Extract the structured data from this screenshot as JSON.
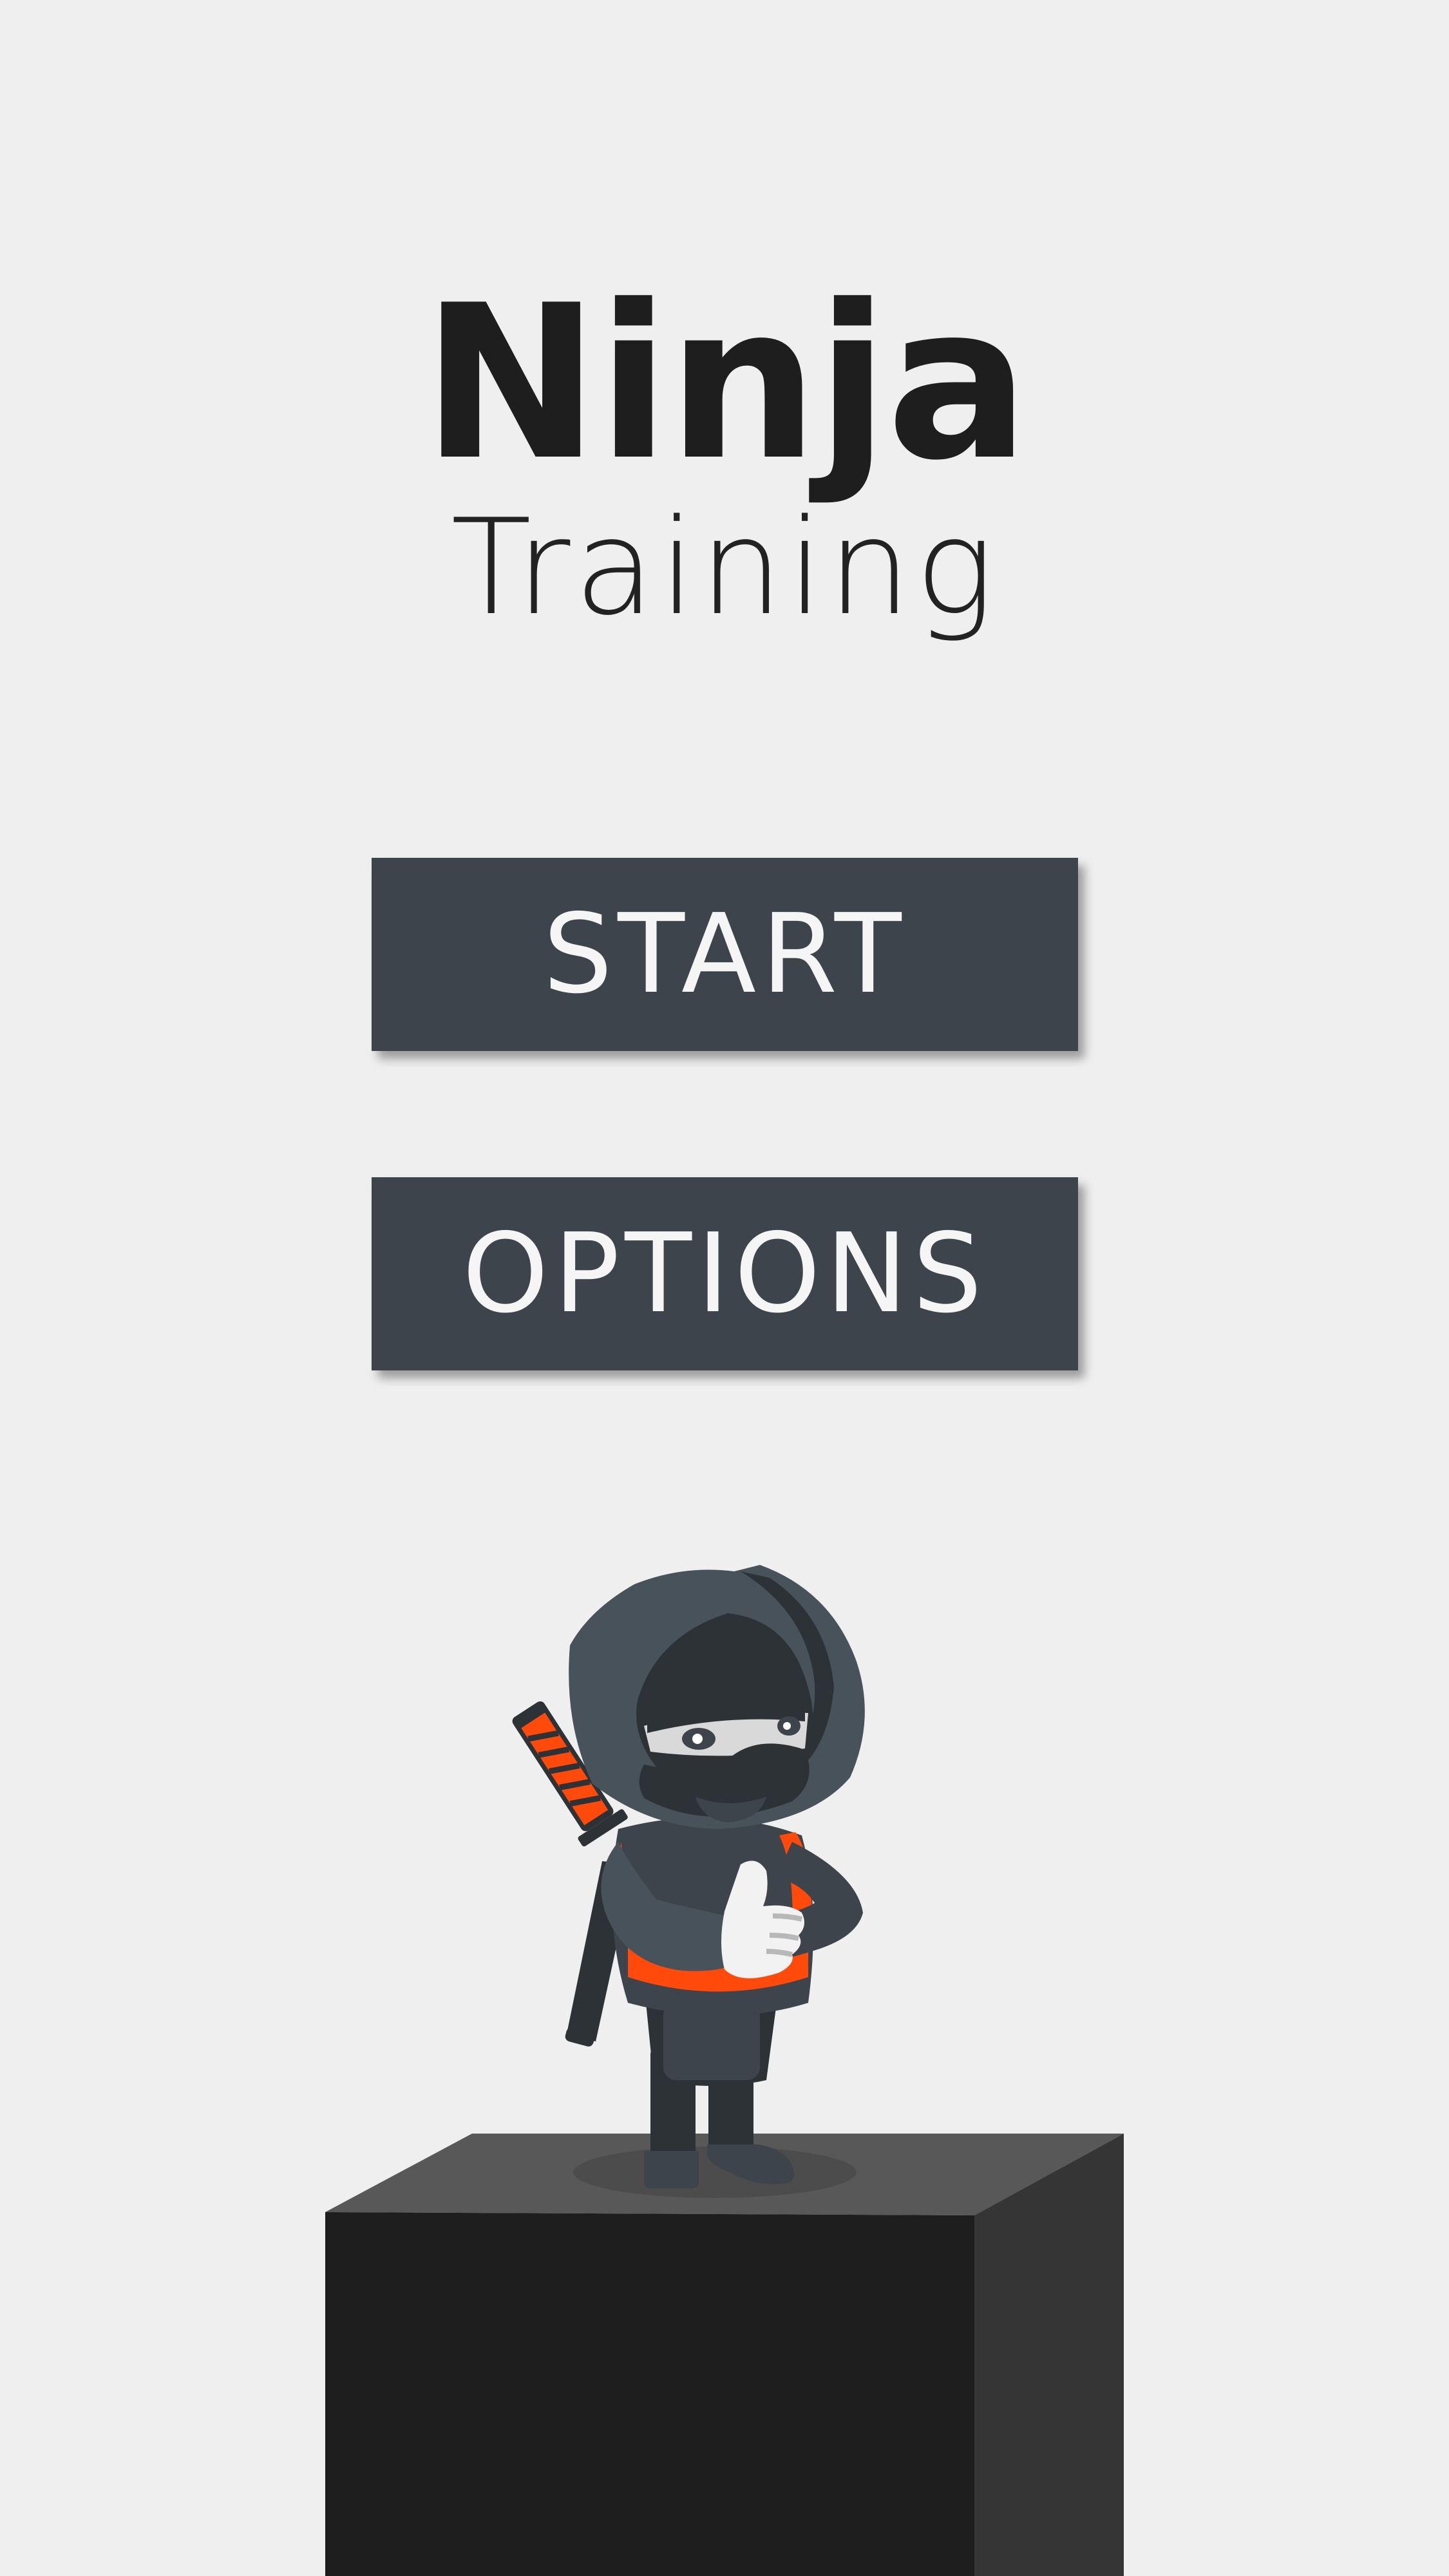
{
  "title": {
    "main": "Ninja",
    "sub": "Training"
  },
  "menu": {
    "start_label": "START",
    "options_label": "OPTIONS"
  },
  "colors": {
    "background": "#efefef",
    "button": "#3d444b",
    "button_text": "#f5f5f5",
    "title_text": "#1e1e1e",
    "ninja_accent": "#ff4a0c",
    "pillar_front": "#1e1e1e",
    "pillar_top": "#585858",
    "pillar_side": "#353535"
  },
  "icons": {
    "character": "ninja-character",
    "platform": "pillar-platform"
  }
}
